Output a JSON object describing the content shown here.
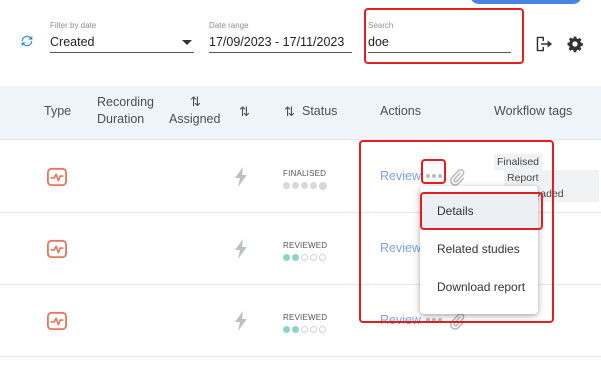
{
  "toolbar": {
    "filter_by_date": {
      "label": "Filter by date",
      "value": "Created"
    },
    "date_range": {
      "label": "Date range",
      "value": "17/09/2023 - 17/11/2023"
    },
    "search": {
      "label": "Search",
      "value": "doe"
    },
    "icons": [
      "refresh-icon",
      "export-icon",
      "gear-icon"
    ]
  },
  "table": {
    "headers": {
      "type": "Type",
      "recording_duration": "Recording\nDuration",
      "assigned": "Assigned",
      "sort_glyph": "⇅",
      "status": "Status",
      "actions": "Actions",
      "workflow_tags": "Workflow tags"
    },
    "rows": [
      {
        "status": "FINALISED",
        "action": "Review",
        "tags": [
          "Finalised",
          "Report downloaded",
          "…d"
        ]
      },
      {
        "status": "REVIEWED",
        "action": "Review",
        "tags": []
      },
      {
        "status": "REVIEWED",
        "action": "Review",
        "tags": []
      }
    ]
  },
  "menu": {
    "items": [
      {
        "label": "Details",
        "selected": true
      },
      {
        "label": "Related studies",
        "selected": false
      },
      {
        "label": "Download report",
        "selected": false
      }
    ]
  },
  "colors": {
    "highlight": "#e02020",
    "accent": "#4a84e0",
    "link": "#7aa3e6",
    "teal": "#8fd3c8",
    "type_icon": "#e07860"
  }
}
